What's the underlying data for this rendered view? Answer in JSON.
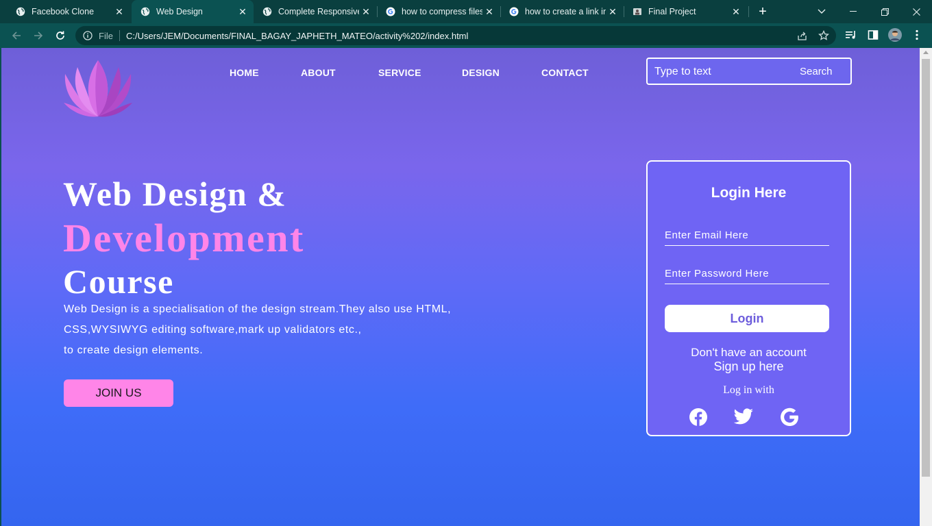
{
  "browser": {
    "tabs": [
      {
        "title": "Facebook Clone",
        "icon": "globe-icon",
        "active": false
      },
      {
        "title": "Web Design",
        "icon": "globe-icon",
        "active": true
      },
      {
        "title": "Complete Responsive",
        "icon": "globe-icon",
        "active": false
      },
      {
        "title": "how to compress files",
        "icon": "google-icon",
        "active": false
      },
      {
        "title": "how to create a link in",
        "icon": "google-icon",
        "active": false
      },
      {
        "title": "Final Project",
        "icon": "image-icon",
        "active": false
      }
    ],
    "omnibox": {
      "scheme_label": "File",
      "url": "C:/Users/JEM/Documents/FINAL_BAGAY_JAPHETH_MATEO/activity%202/index.html"
    },
    "colors": {
      "frame": "#0a3f3f",
      "toolbar": "#0b5252"
    }
  },
  "page": {
    "nav": [
      "HOME",
      "ABOUT",
      "SERVICE",
      "DESIGN",
      "CONTACT"
    ],
    "search": {
      "placeholder": "Type to text",
      "button": "Search"
    },
    "hero": {
      "line1": "Web Design &",
      "line2": "Development",
      "line3": "Course",
      "description": [
        "Web Design is a specialisation of the design stream.They also use HTML,",
        "CSS,WYSIWYG editing software,mark up validators etc.,",
        "to create design elements."
      ],
      "cta": "JOIN US"
    },
    "login": {
      "title": "Login Here",
      "email_placeholder": "Enter Email Here",
      "password_placeholder": "Enter Password Here",
      "button": "Login",
      "no_account": "Don't have an account",
      "signup": "Sign up here",
      "login_with": "Log in with",
      "socials": [
        "facebook-icon",
        "twitter-icon",
        "google-icon"
      ]
    },
    "colors": {
      "accent_pink": "#ff85e8",
      "card": "#6f64f4",
      "gradient_top": "#6e5fd8",
      "gradient_bottom": "#3465ef"
    }
  }
}
